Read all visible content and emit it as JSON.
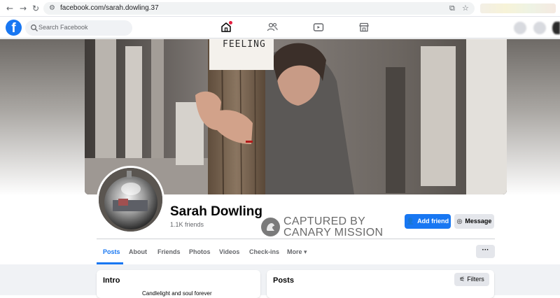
{
  "browser": {
    "url": "facebook.com/sarah.dowling.37",
    "icons": [
      "back-icon",
      "forward-icon",
      "reload-icon",
      "site-info-icon",
      "install-app-icon",
      "bookmark-star-icon"
    ]
  },
  "header": {
    "logo_letter": "f",
    "search_placeholder": "Search Facebook",
    "nav_icons": [
      "home-icon",
      "friends-icon",
      "video-icon",
      "marketplace-icon"
    ],
    "accent_color": "#1877f2",
    "notification_color": "#e41e3f"
  },
  "cover": {
    "sign_text": "FEELING"
  },
  "profile": {
    "name": "Sarah Dowling",
    "friends": "1.1K friends",
    "add_friend_label": "Add friend",
    "message_label": "Message"
  },
  "watermark": {
    "line1": "CAPTURED BY",
    "line2": "CANARY MISSION"
  },
  "tabs": [
    {
      "label": "Posts",
      "active": true
    },
    {
      "label": "About",
      "active": false
    },
    {
      "label": "Friends",
      "active": false
    },
    {
      "label": "Photos",
      "active": false
    },
    {
      "label": "Videos",
      "active": false
    },
    {
      "label": "Check-ins",
      "active": false
    },
    {
      "label": "More",
      "active": false
    }
  ],
  "tabs_more_caret": "▾",
  "more_options_label": "···",
  "intro": {
    "title": "Intro",
    "bio": "Candlelight and soul forever"
  },
  "posts": {
    "title": "Posts",
    "filters_label": "Filters"
  }
}
